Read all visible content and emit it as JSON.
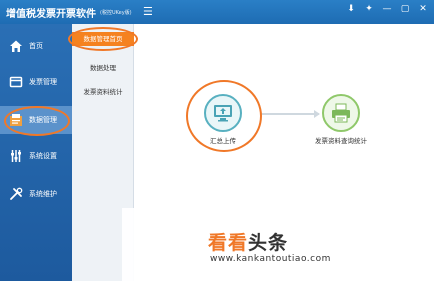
{
  "app": {
    "title": "增值税发票开票软件",
    "version": "(税控UKey版)",
    "menu_icon": "menu-icon",
    "window_controls": [
      "download-icon",
      "pin-icon",
      "minimize-icon",
      "maximize-icon",
      "close-icon"
    ]
  },
  "sidebar": {
    "items": [
      {
        "label": "首页",
        "icon": "home-icon"
      },
      {
        "label": "发票管理",
        "icon": "invoice-icon"
      },
      {
        "label": "数据管理",
        "icon": "data-icon",
        "active": true
      },
      {
        "label": "系统设置",
        "icon": "settings-icon"
      },
      {
        "label": "系统维护",
        "icon": "tools-icon"
      }
    ]
  },
  "submenu": {
    "items": [
      {
        "label": "数据管理首页",
        "active": true
      },
      {
        "label": "数据处理"
      },
      {
        "label": "发票资料统计"
      }
    ]
  },
  "flow": {
    "nodes": [
      {
        "label": "汇总上传",
        "icon": "upload-monitor-icon"
      },
      {
        "label": "发票资料查询统计",
        "icon": "printer-report-icon"
      }
    ]
  },
  "watermark": {
    "part1": "看看",
    "part2": "头条",
    "url": "www.kankantoutiao.com"
  },
  "colors": {
    "titlebar": "#1e6cb3",
    "sidebar": "#2a6fb5",
    "accent": "#f58220",
    "annotation": "#f07828"
  }
}
